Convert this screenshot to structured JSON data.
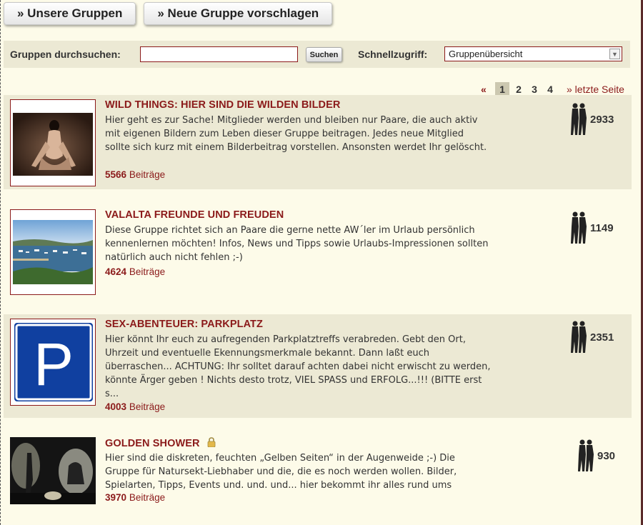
{
  "nav": {
    "groups_label": "» Unsere Gruppen",
    "suggest_label": "» Neue Gruppe vorschlagen"
  },
  "search": {
    "label": "Gruppen durchsuchen:",
    "value": "",
    "button": "Suchen",
    "quick_label": "Schnellzugriff:",
    "quick_value": "Gruppenübersicht"
  },
  "pagination": {
    "prev": "«",
    "pages": [
      "1",
      "2",
      "3",
      "4"
    ],
    "current": "1",
    "last": "» letzte Seite"
  },
  "groups": [
    {
      "title": "WILD THINGS: HIER SIND DIE WILDEN BILDER",
      "description": "Hier geht es zur Sache! Mitglieder werden und bleiben nur Paare, die auch aktiv mit eigenen Bildern zum Leben dieser Gruppe beitragen. Jedes neue Mitglied sollte sich kurz mit einem Bilderbeitrag vorstellen. Ansonsten werdet Ihr gelöscht.",
      "posts": "5566",
      "posts_label": "Beiträge",
      "members": "2933"
    },
    {
      "title": "VALALTA FREUNDE UND FREUDEN",
      "description": "Diese Gruppe richtet sich an Paare die gerne nette AW´ler im Urlaub persönlich kennenlernen möchten! Infos, News und Tipps sowie Urlaubs-Impressionen sollten natürlich auch nicht fehlen ;-)",
      "posts": "4624",
      "posts_label": "Beiträge",
      "members": "1149"
    },
    {
      "title": "SEX-ABENTEUER: PARKPLATZ",
      "description": "Hier könnt Ihr euch zu aufregenden Parkplatztreffs verabreden. Gebt den Ort, Uhrzeit und eventuelle Ekennungsmerkmale bekannt. Dann laßt euch überraschen... ACHTUNG: Ihr solltet darauf achten dabei nicht erwischt zu werden, könnte Ärger geben ! Nichts desto trotz, VIEL SPASS und ERFOLG...!!! (BITTE erst s...",
      "posts": "4003",
      "posts_label": "Beiträge",
      "members": "2351",
      "thumb_letter": "P"
    },
    {
      "title": "GOLDEN SHOWER",
      "description": "Hier sind die diskreten, feuchten „Gelben Seiten“ in der Augenweide ;-) Die Gruppe für Natursekt-Liebhaber und die, die es noch werden wollen. Bilder, Spielarten, Tipps, Events und. und. und... hier bekommt ihr alles rund ums",
      "posts": "3970",
      "posts_label": "Beiträge",
      "members": "930",
      "locked": true
    }
  ],
  "colors": {
    "accent": "#8b1a1a",
    "row_bg": "#ece9d4",
    "page_bg": "#fdfbe9",
    "parking_blue": "#1040a0"
  }
}
